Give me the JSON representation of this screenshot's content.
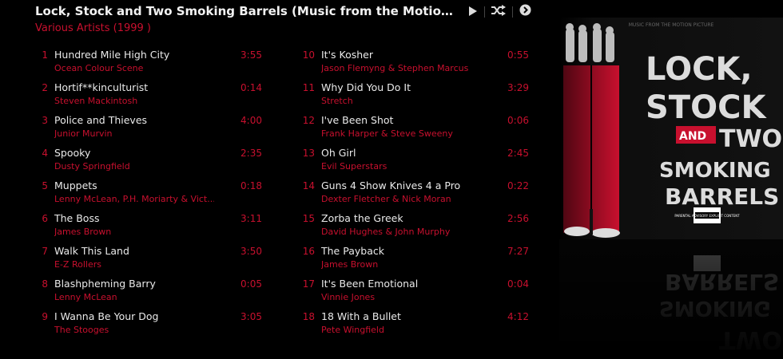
{
  "header": {
    "title": "Lock, Stock and Two Smoking Barrels (Music from the Motion Pic...",
    "subtitle": "Various Artists (1999 )"
  },
  "controls": {
    "play_icon": "play-icon",
    "shuffle_icon": "shuffle-icon",
    "more_icon": "circle-chevron-right-icon"
  },
  "tracks_left": [
    {
      "num": "1",
      "name": "Hundred Mile High City",
      "artist": "Ocean Colour Scene",
      "dur": "3:55"
    },
    {
      "num": "2",
      "name": "Hortif**kinculturist",
      "artist": "Steven Mackintosh",
      "dur": "0:14"
    },
    {
      "num": "3",
      "name": "Police and Thieves",
      "artist": "Junior Murvin",
      "dur": "4:00"
    },
    {
      "num": "4",
      "name": "Spooky",
      "artist": "Dusty Springfield",
      "dur": "2:35"
    },
    {
      "num": "5",
      "name": "Muppets",
      "artist": "Lenny McLean, P.H. Moriarty & Vict...",
      "dur": "0:18"
    },
    {
      "num": "6",
      "name": "The Boss",
      "artist": "James Brown",
      "dur": "3:11"
    },
    {
      "num": "7",
      "name": "Walk This Land",
      "artist": "E-Z Rollers",
      "dur": "3:50"
    },
    {
      "num": "8",
      "name": "Blashpheming Barry",
      "artist": "Lenny McLean",
      "dur": "0:05"
    },
    {
      "num": "9",
      "name": "I Wanna Be Your Dog",
      "artist": "The Stooges",
      "dur": "3:05"
    }
  ],
  "tracks_right": [
    {
      "num": "10",
      "name": "It's Kosher",
      "artist": "Jason Flemyng & Stephen Marcus",
      "dur": "0:55"
    },
    {
      "num": "11",
      "name": "Why Did You Do It",
      "artist": "Stretch",
      "dur": "3:29"
    },
    {
      "num": "12",
      "name": "I've Been Shot",
      "artist": "Frank Harper & Steve Sweeny",
      "dur": "0:06"
    },
    {
      "num": "13",
      "name": "Oh Girl",
      "artist": "Evil Superstars",
      "dur": "2:45"
    },
    {
      "num": "14",
      "name": "Guns 4 Show Knives 4 a Pro",
      "artist": "Dexter Fletcher & Nick Moran",
      "dur": "0:22"
    },
    {
      "num": "15",
      "name": "Zorba the Greek",
      "artist": "David Hughes & John Murphy",
      "dur": "2:56"
    },
    {
      "num": "16",
      "name": "The Payback",
      "artist": "James Brown",
      "dur": "7:27"
    },
    {
      "num": "17",
      "name": "It's Been Emotional",
      "artist": "Vinnie Jones",
      "dur": "0:04"
    },
    {
      "num": "18",
      "name": "18 With a Bullet",
      "artist": "Pete Wingfield",
      "dur": "4:12"
    }
  ],
  "album_art": {
    "line1": "LOCK,",
    "line2": "STOCK",
    "line3a": "AND",
    "line3b": "TWO",
    "line4": "SMOKING",
    "line5": "BARRELS",
    "badge": "PARENTAL ADVISORY EXPLICIT CONTENT",
    "top_text": "MUSIC FROM THE MOTION PICTURE",
    "accent": "#c8102e"
  },
  "colors": {
    "background": "#000000",
    "accent": "#c8102e",
    "text": "#eaeaea"
  }
}
